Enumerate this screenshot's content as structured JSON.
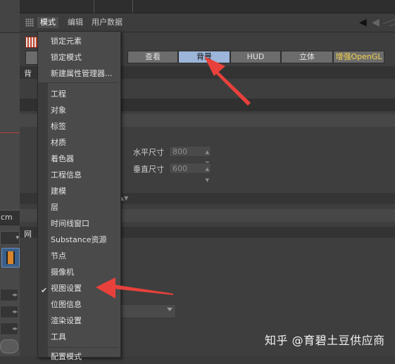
{
  "viewport": {
    "unit_value": "cm"
  },
  "attribute_manager": {
    "menus": [
      "模式",
      "编辑",
      "用户数据"
    ],
    "tabs": [
      {
        "label": "查看",
        "active": false
      },
      {
        "label": "背景",
        "active": true
      },
      {
        "label": "HUD",
        "active": false
      },
      {
        "label": "立体",
        "active": false
      },
      {
        "label": "增强OpenGL",
        "active": false
      }
    ],
    "section_label_partial": "背",
    "grid_label_partial": "网",
    "fields": {
      "horizontal_size_label": "水平尺寸",
      "horizontal_size_value": "800",
      "vertical_size_label": "垂直尺寸",
      "vertical_size_value": "600"
    }
  },
  "mode_menu": {
    "top_items": [
      "锁定元素",
      "锁定模式",
      "新建属性管理器..."
    ],
    "items": [
      "工程",
      "对象",
      "标签",
      "材质",
      "着色器",
      "工程信息",
      "建模",
      "层",
      "时间线窗口",
      "Substance资源",
      "节点",
      "摄像机",
      "视图设置",
      "位图信息",
      "渲染设置",
      "工具"
    ],
    "checked_item": "视图设置",
    "last_partial_item": "配置模式"
  },
  "colors": {
    "active_tab": "#9cb5d8",
    "opengl_tab_text": "#f3d34a",
    "annotation_arrow": "#e8413b"
  },
  "watermark": "知乎 @育碧土豆供应商"
}
